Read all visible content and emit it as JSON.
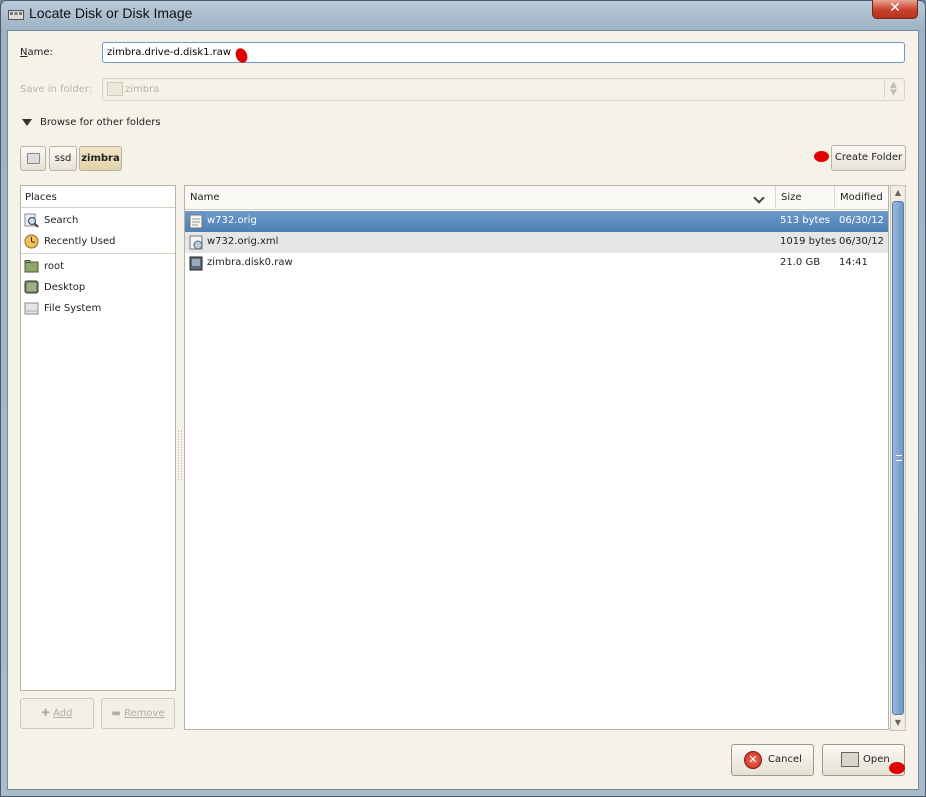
{
  "window": {
    "title": "Locate Disk or Disk Image",
    "close_glyph": "✕"
  },
  "form": {
    "name_label": "Name:",
    "name_value": "zimbra.drive-d.disk1.raw",
    "save_in_label": "Save in folder:",
    "save_in_value": "zimbra",
    "browse_label": "Browse for other folders"
  },
  "path_bar": {
    "items": [
      "ssd",
      "zimbra"
    ],
    "create_folder_label": "Create Folder"
  },
  "places": {
    "header": "Places",
    "items": [
      {
        "label": "Search",
        "icon": "search-icon"
      },
      {
        "label": "Recently Used",
        "icon": "recently-used-icon"
      },
      {
        "label": "root",
        "icon": "home-folder-icon"
      },
      {
        "label": "Desktop",
        "icon": "desktop-icon"
      },
      {
        "label": "File System",
        "icon": "drive-icon"
      }
    ],
    "add_label": "Add",
    "remove_label": "Remove"
  },
  "file_list": {
    "columns": [
      "Name",
      "Size",
      "Modified"
    ],
    "rows": [
      {
        "name": "w732.orig",
        "size": "513 bytes",
        "modified": "06/30/12",
        "icon": "text-file-icon",
        "selected": true
      },
      {
        "name": "w732.orig.xml",
        "size": "1019 bytes",
        "modified": "06/30/12",
        "icon": "xml-file-icon",
        "selected": false
      },
      {
        "name": "zimbra.disk0.raw",
        "size": "21.0 GB",
        "modified": "14:41",
        "icon": "disk-image-icon",
        "selected": false
      }
    ]
  },
  "dialog_buttons": {
    "cancel_label": "Cancel",
    "open_label": "Open"
  },
  "colors": {
    "selection": "#4d7fb6",
    "close_button": "#c9402c",
    "annotation_mark": "#e00000"
  }
}
